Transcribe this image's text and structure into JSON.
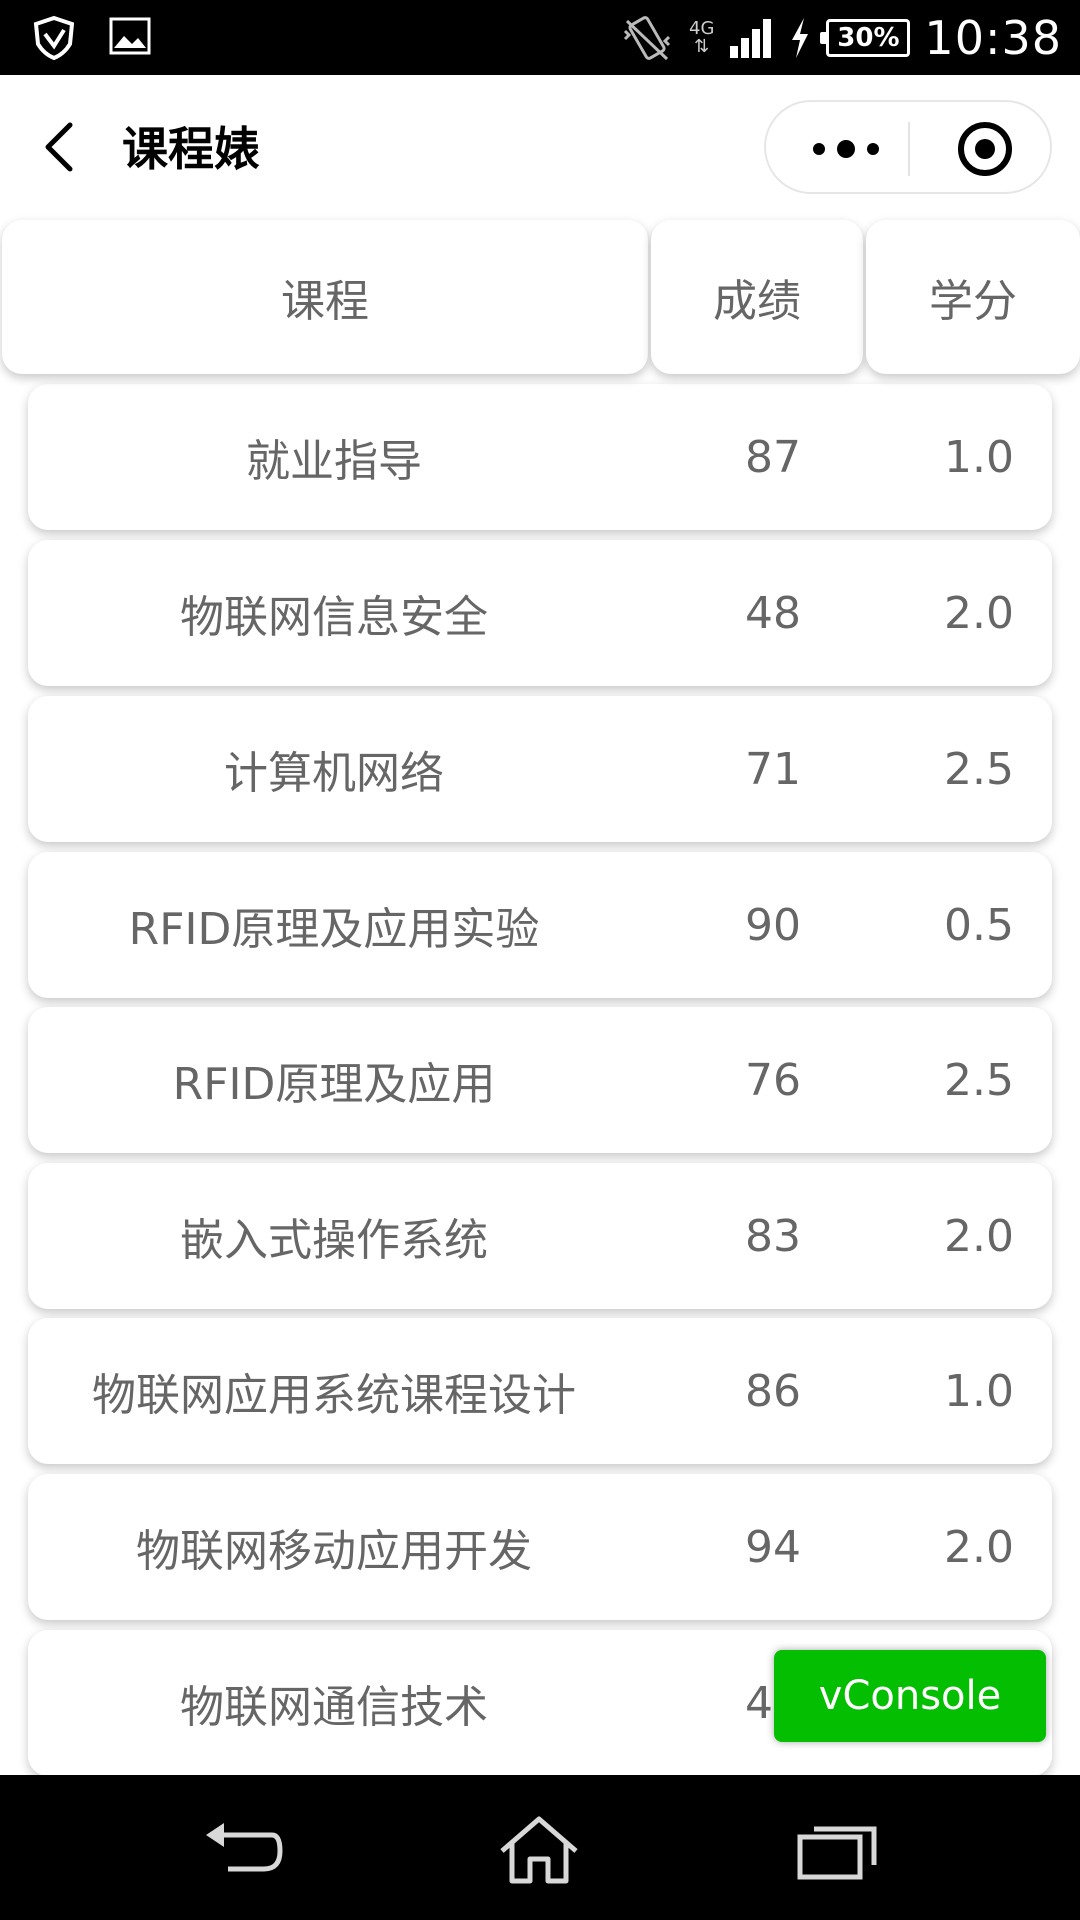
{
  "status_bar": {
    "network": "4G",
    "battery": "30%",
    "time": "10:38"
  },
  "nav": {
    "title": "课程婊"
  },
  "table": {
    "headers": [
      "课程",
      "成绩",
      "学分"
    ],
    "rows": [
      {
        "course": "就业指导",
        "score": "87",
        "credit": "1.0"
      },
      {
        "course": "物联网信息安全",
        "score": "48",
        "credit": "2.0"
      },
      {
        "course": "计算机网络",
        "score": "71",
        "credit": "2.5"
      },
      {
        "course": "RFID原理及应用实验",
        "score": "90",
        "credit": "0.5"
      },
      {
        "course": "RFID原理及应用",
        "score": "76",
        "credit": "2.5"
      },
      {
        "course": "嵌入式操作系统",
        "score": "83",
        "credit": "2.0"
      },
      {
        "course": "物联网应用系统课程设计",
        "score": "86",
        "credit": "1.0"
      },
      {
        "course": "物联网移动应用开发",
        "score": "94",
        "credit": "2.0"
      },
      {
        "course": "物联网通信技术",
        "score": "40",
        "credit": ""
      }
    ]
  },
  "vconsole": {
    "label": "vConsole",
    "color": "#04be02"
  },
  "icons": {
    "status_left": [
      "shield-icon",
      "image-icon"
    ],
    "status_right": [
      "vibrate-icon",
      "signal-icon",
      "charging-icon"
    ],
    "nav": [
      "back-icon",
      "more-icon",
      "target-icon"
    ],
    "bottom": [
      "back-arrow-icon",
      "home-icon",
      "recent-apps-icon"
    ]
  }
}
